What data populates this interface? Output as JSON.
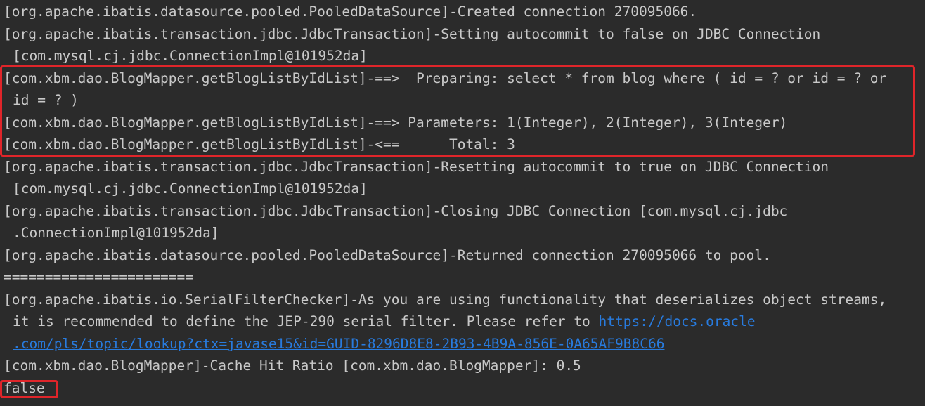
{
  "colors": {
    "background": "#2b2b2b",
    "text": "#c9c9c9",
    "link": "#287bde",
    "highlight_border": "#e0252a"
  },
  "console": {
    "line1": "[org.apache.ibatis.datasource.pooled.PooledDataSource]-Created connection 270095066.",
    "line2": "[org.apache.ibatis.transaction.jdbc.JdbcTransaction]-Setting autocommit to false on JDBC Connection",
    "line3": "[com.mysql.cj.jdbc.ConnectionImpl@101952da]",
    "line4": "[com.xbm.dao.BlogMapper.getBlogListByIdList]-==>  Preparing: select * from blog where ( id = ? or id = ? or",
    "line5": "id = ? )",
    "line6": "[com.xbm.dao.BlogMapper.getBlogListByIdList]-==> Parameters: 1(Integer), 2(Integer), 3(Integer)",
    "line7": "[com.xbm.dao.BlogMapper.getBlogListByIdList]-<==      Total: 3",
    "line8": "[org.apache.ibatis.transaction.jdbc.JdbcTransaction]-Resetting autocommit to true on JDBC Connection",
    "line9": "[com.mysql.cj.jdbc.ConnectionImpl@101952da]",
    "line10": "[org.apache.ibatis.transaction.jdbc.JdbcTransaction]-Closing JDBC Connection [com.mysql.cj.jdbc",
    "line11": ".ConnectionImpl@101952da]",
    "line12": "[org.apache.ibatis.datasource.pooled.PooledDataSource]-Returned connection 270095066 to pool.",
    "line13": "=======================",
    "line14": "[org.apache.ibatis.io.SerialFilterChecker]-As you are using functionality that deserializes object streams,",
    "line15_text": "it is recommended to define the JEP-290 serial filter. Please refer to ",
    "line15_link": "https://docs.oracle",
    "line16_link": ".com/pls/topic/lookup?ctx=javase15&id=GUID-8296D8E8-2B93-4B9A-856E-0A65AF9B8C66",
    "line17": "[com.xbm.dao.BlogMapper]-Cache Hit Ratio [com.xbm.dao.BlogMapper]: 0.5",
    "line18": "false"
  }
}
